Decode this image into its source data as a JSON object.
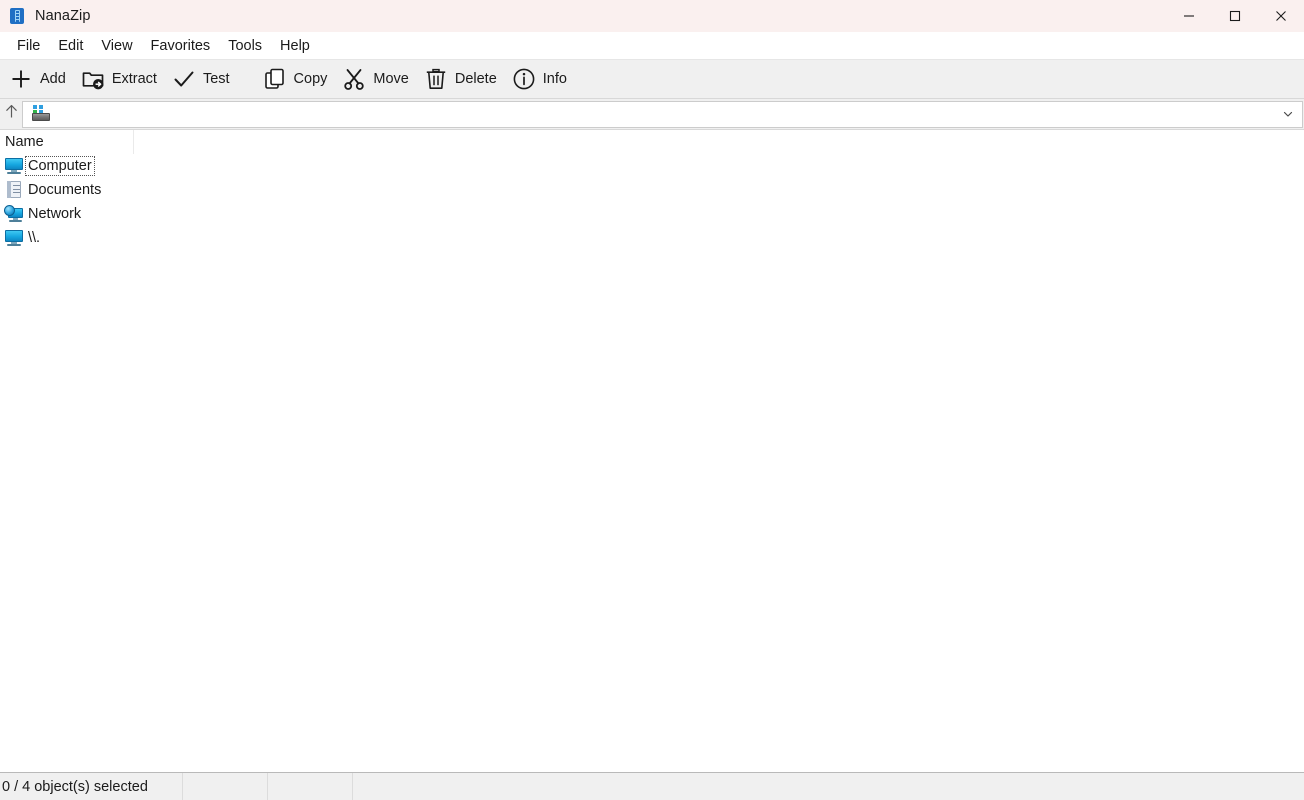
{
  "window": {
    "title": "NanaZip",
    "app_icon": "nanazip-icon",
    "controls": [
      {
        "name": "minimize",
        "icon": "minimize-icon"
      },
      {
        "name": "maximize",
        "icon": "maximize-icon"
      },
      {
        "name": "close",
        "icon": "close-icon"
      }
    ]
  },
  "menubar": {
    "items": [
      {
        "label": "File"
      },
      {
        "label": "Edit"
      },
      {
        "label": "View"
      },
      {
        "label": "Favorites"
      },
      {
        "label": "Tools"
      },
      {
        "label": "Help"
      }
    ]
  },
  "toolbar": {
    "buttons": [
      {
        "label": "Add",
        "icon": "plus-icon"
      },
      {
        "label": "Extract",
        "icon": "folder-extract-icon"
      },
      {
        "label": "Test",
        "icon": "checkmark-icon"
      },
      {
        "label": "Copy",
        "icon": "copy-pages-icon"
      },
      {
        "label": "Move",
        "icon": "scissors-icon"
      },
      {
        "label": "Delete",
        "icon": "trash-icon"
      },
      {
        "label": "Info",
        "icon": "info-circle-icon"
      }
    ]
  },
  "addressbar": {
    "up_icon": "arrow-up-icon",
    "location_icon": "computer-icon",
    "path": "",
    "placeholder": "",
    "dropdown_icon": "chevron-down-icon"
  },
  "listview": {
    "columns": [
      {
        "label": "Name"
      }
    ],
    "rows": [
      {
        "label": "Computer",
        "icon": "monitor-icon",
        "focused": true
      },
      {
        "label": "Documents",
        "icon": "document-icon",
        "focused": false
      },
      {
        "label": "Network",
        "icon": "network-icon",
        "focused": false
      },
      {
        "label": "\\\\.",
        "icon": "monitor-icon",
        "focused": false
      }
    ]
  },
  "statusbar": {
    "panes": [
      {
        "text": "0 / 4 object(s) selected"
      },
      {
        "text": ""
      },
      {
        "text": ""
      },
      {
        "text": ""
      }
    ]
  },
  "colors": {
    "titlebar_bg": "#faf0ef",
    "toolbar_bg": "#f0f0f0",
    "statusbar_bg": "#f0f0f0",
    "content_bg": "#ffffff",
    "text": "#1b1b1b",
    "accent_blue": "#16a7e0"
  }
}
